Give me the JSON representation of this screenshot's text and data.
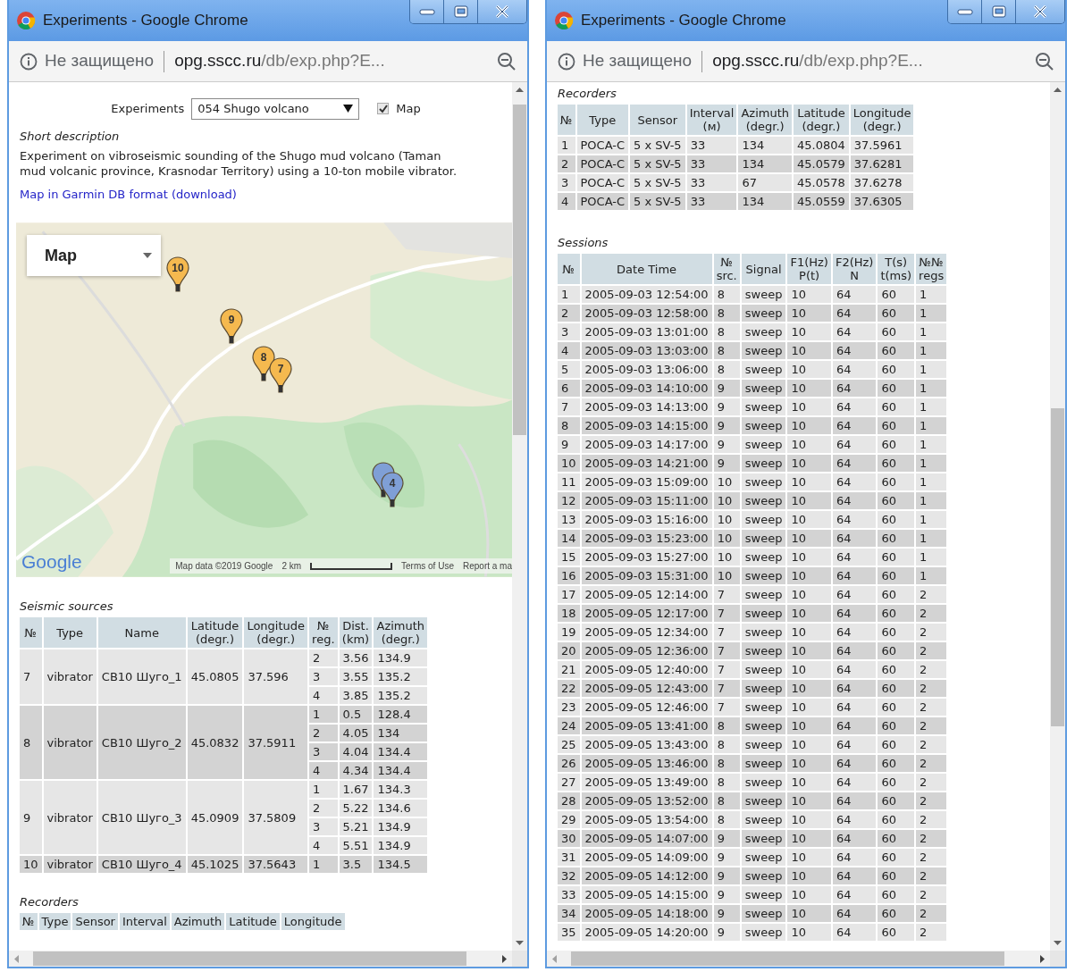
{
  "windows": [
    {
      "title": "Experiments - Google Chrome",
      "address": {
        "security": "Не защищено",
        "host": "opg.sscc.ru",
        "path": "/db/exp.php?E..."
      },
      "experiments_label": "Experiments",
      "experiment_select": "054 Shugo volcano",
      "map_toggle": {
        "label": "Map",
        "checked": true
      },
      "description_heading": "Short description",
      "description": "Experiment on vibroseismic sounding of the Shugo mud volcano (Taman mud volcanic province, Krasnodar Territory) using a 10-ton mobile vibrator.",
      "download_link": "Map in Garmin DB format (download)",
      "map": {
        "kind": "picture",
        "type_control": "Map",
        "logo": "Google",
        "attribution": "Map data ©2019 Google",
        "scale": "2 km",
        "terms": "Terms of Use",
        "report": "Report a ma",
        "markers": [
          {
            "label": "10",
            "color": "#f5b94f"
          },
          {
            "label": "9",
            "color": "#f5b94f"
          },
          {
            "label": "8",
            "color": "#f5b94f"
          },
          {
            "label": "7",
            "color": "#f5b94f"
          },
          {
            "color": "#7f9fd6"
          },
          {
            "label": "4",
            "color": "#7f9fd6"
          }
        ]
      },
      "sections": [
        {
          "kind": "sources",
          "heading": "Seismic sources",
          "columns": [
            "№",
            "Type",
            "Name",
            "Latitude\n(degr.)",
            "Longitude\n(degr.)",
            "№\nreg.",
            "Dist.\n(km)",
            "Azimuth\n(degr.)"
          ],
          "sources": [
            {
              "cells": [
                "7",
                "vibrator",
                "CB10 Шуго_1",
                "45.0805",
                "37.596"
              ],
              "registrations": [
                [
                  "2",
                  "3.56",
                  "134.9"
                ],
                [
                  "3",
                  "3.55",
                  "135.2"
                ],
                [
                  "4",
                  "3.85",
                  "135.2"
                ]
              ]
            },
            {
              "cells": [
                "8",
                "vibrator",
                "CB10 Шуго_2",
                "45.0832",
                "37.5911"
              ],
              "registrations": [
                [
                  "1",
                  "0.5",
                  "128.4"
                ],
                [
                  "2",
                  "4.05",
                  "134"
                ],
                [
                  "3",
                  "4.04",
                  "134.4"
                ],
                [
                  "4",
                  "4.34",
                  "134.4"
                ]
              ]
            },
            {
              "cells": [
                "9",
                "vibrator",
                "CB10 Шуго_3",
                "45.0909",
                "37.5809"
              ],
              "registrations": [
                [
                  "1",
                  "1.67",
                  "134.3"
                ],
                [
                  "2",
                  "5.22",
                  "134.6"
                ],
                [
                  "3",
                  "5.21",
                  "134.9"
                ],
                [
                  "4",
                  "5.51",
                  "134.9"
                ]
              ]
            },
            {
              "cells": [
                "10",
                "vibrator",
                "CB10 Шуго_4",
                "45.1025",
                "37.5643"
              ],
              "registrations": [
                [
                  "1",
                  "3.5",
                  "134.5"
                ]
              ]
            }
          ]
        },
        {
          "kind": "table",
          "heading": "Recorders",
          "columns": [
            "№",
            "Type",
            "Sensor",
            "Interval",
            "Azimuth",
            "Latitude",
            "Longitude"
          ]
        }
      ]
    },
    {
      "title": "Experiments - Google Chrome",
      "address": {
        "security": "Не защищено",
        "host": "opg.sscc.ru",
        "path": "/db/exp.php?E..."
      },
      "sections": [
        {
          "kind": "table",
          "heading": "Recorders",
          "columns": [
            "№",
            "Type",
            "Sensor",
            "Interval\n(м)",
            "Azimuth\n(degr.)",
            "Latitude\n(degr.)",
            "Longitude\n(degr.)"
          ],
          "rows": [
            [
              "1",
              "POCA-C",
              "5 x SV-5",
              "33",
              "134",
              "45.0804",
              "37.5961"
            ],
            [
              "2",
              "POCA-C",
              "5 x SV-5",
              "33",
              "134",
              "45.0579",
              "37.6281"
            ],
            [
              "3",
              "POCA-C",
              "5 x SV-5",
              "33",
              "67",
              "45.0578",
              "37.6278"
            ],
            [
              "4",
              "POCA-C",
              "5 x SV-5",
              "33",
              "134",
              "45.0559",
              "37.6305"
            ]
          ]
        },
        {
          "kind": "table",
          "heading": "Sessions",
          "columns": [
            "№",
            "Date Time",
            "№\nsrc.",
            "Signal",
            "F1(Hz)\nP(t)",
            "F2(Hz)\nN",
            "T(s)\nt(ms)",
            "№№\nregs"
          ],
          "rows": [
            [
              "1",
              "2005-09-03 12:54:00",
              "8",
              "sweep",
              "10",
              "64",
              "60",
              "1"
            ],
            [
              "2",
              "2005-09-03 12:58:00",
              "8",
              "sweep",
              "10",
              "64",
              "60",
              "1"
            ],
            [
              "3",
              "2005-09-03 13:01:00",
              "8",
              "sweep",
              "10",
              "64",
              "60",
              "1"
            ],
            [
              "4",
              "2005-09-03 13:03:00",
              "8",
              "sweep",
              "10",
              "64",
              "60",
              "1"
            ],
            [
              "5",
              "2005-09-03 13:06:00",
              "8",
              "sweep",
              "10",
              "64",
              "60",
              "1"
            ],
            [
              "6",
              "2005-09-03 14:10:00",
              "9",
              "sweep",
              "10",
              "64",
              "60",
              "1"
            ],
            [
              "7",
              "2005-09-03 14:13:00",
              "9",
              "sweep",
              "10",
              "64",
              "60",
              "1"
            ],
            [
              "8",
              "2005-09-03 14:15:00",
              "9",
              "sweep",
              "10",
              "64",
              "60",
              "1"
            ],
            [
              "9",
              "2005-09-03 14:17:00",
              "9",
              "sweep",
              "10",
              "64",
              "60",
              "1"
            ],
            [
              "10",
              "2005-09-03 14:21:00",
              "9",
              "sweep",
              "10",
              "64",
              "60",
              "1"
            ],
            [
              "11",
              "2005-09-03 15:09:00",
              "10",
              "sweep",
              "10",
              "64",
              "60",
              "1"
            ],
            [
              "12",
              "2005-09-03 15:11:00",
              "10",
              "sweep",
              "10",
              "64",
              "60",
              "1"
            ],
            [
              "13",
              "2005-09-03 15:16:00",
              "10",
              "sweep",
              "10",
              "64",
              "60",
              "1"
            ],
            [
              "14",
              "2005-09-03 15:23:00",
              "10",
              "sweep",
              "10",
              "64",
              "60",
              "1"
            ],
            [
              "15",
              "2005-09-03 15:27:00",
              "10",
              "sweep",
              "10",
              "64",
              "60",
              "1"
            ],
            [
              "16",
              "2005-09-03 15:31:00",
              "10",
              "sweep",
              "10",
              "64",
              "60",
              "1"
            ],
            [
              "17",
              "2005-09-05 12:14:00",
              "7",
              "sweep",
              "10",
              "64",
              "60",
              "2"
            ],
            [
              "18",
              "2005-09-05 12:17:00",
              "7",
              "sweep",
              "10",
              "64",
              "60",
              "2"
            ],
            [
              "19",
              "2005-09-05 12:34:00",
              "7",
              "sweep",
              "10",
              "64",
              "60",
              "2"
            ],
            [
              "20",
              "2005-09-05 12:36:00",
              "7",
              "sweep",
              "10",
              "64",
              "60",
              "2"
            ],
            [
              "21",
              "2005-09-05 12:40:00",
              "7",
              "sweep",
              "10",
              "64",
              "60",
              "2"
            ],
            [
              "22",
              "2005-09-05 12:43:00",
              "7",
              "sweep",
              "10",
              "64",
              "60",
              "2"
            ],
            [
              "23",
              "2005-09-05 12:46:00",
              "7",
              "sweep",
              "10",
              "64",
              "60",
              "2"
            ],
            [
              "24",
              "2005-09-05 13:41:00",
              "8",
              "sweep",
              "10",
              "64",
              "60",
              "2"
            ],
            [
              "25",
              "2005-09-05 13:43:00",
              "8",
              "sweep",
              "10",
              "64",
              "60",
              "2"
            ],
            [
              "26",
              "2005-09-05 13:46:00",
              "8",
              "sweep",
              "10",
              "64",
              "60",
              "2"
            ],
            [
              "27",
              "2005-09-05 13:49:00",
              "8",
              "sweep",
              "10",
              "64",
              "60",
              "2"
            ],
            [
              "28",
              "2005-09-05 13:52:00",
              "8",
              "sweep",
              "10",
              "64",
              "60",
              "2"
            ],
            [
              "29",
              "2005-09-05 13:54:00",
              "8",
              "sweep",
              "10",
              "64",
              "60",
              "2"
            ],
            [
              "30",
              "2005-09-05 14:07:00",
              "9",
              "sweep",
              "10",
              "64",
              "60",
              "2"
            ],
            [
              "31",
              "2005-09-05 14:09:00",
              "9",
              "sweep",
              "10",
              "64",
              "60",
              "2"
            ],
            [
              "32",
              "2005-09-05 14:12:00",
              "9",
              "sweep",
              "10",
              "64",
              "60",
              "2"
            ],
            [
              "33",
              "2005-09-05 14:15:00",
              "9",
              "sweep",
              "10",
              "64",
              "60",
              "2"
            ],
            [
              "34",
              "2005-09-05 14:18:00",
              "9",
              "sweep",
              "10",
              "64",
              "60",
              "2"
            ],
            [
              "35",
              "2005-09-05 14:20:00",
              "9",
              "sweep",
              "10",
              "64",
              "60",
              "2"
            ]
          ]
        }
      ]
    }
  ]
}
